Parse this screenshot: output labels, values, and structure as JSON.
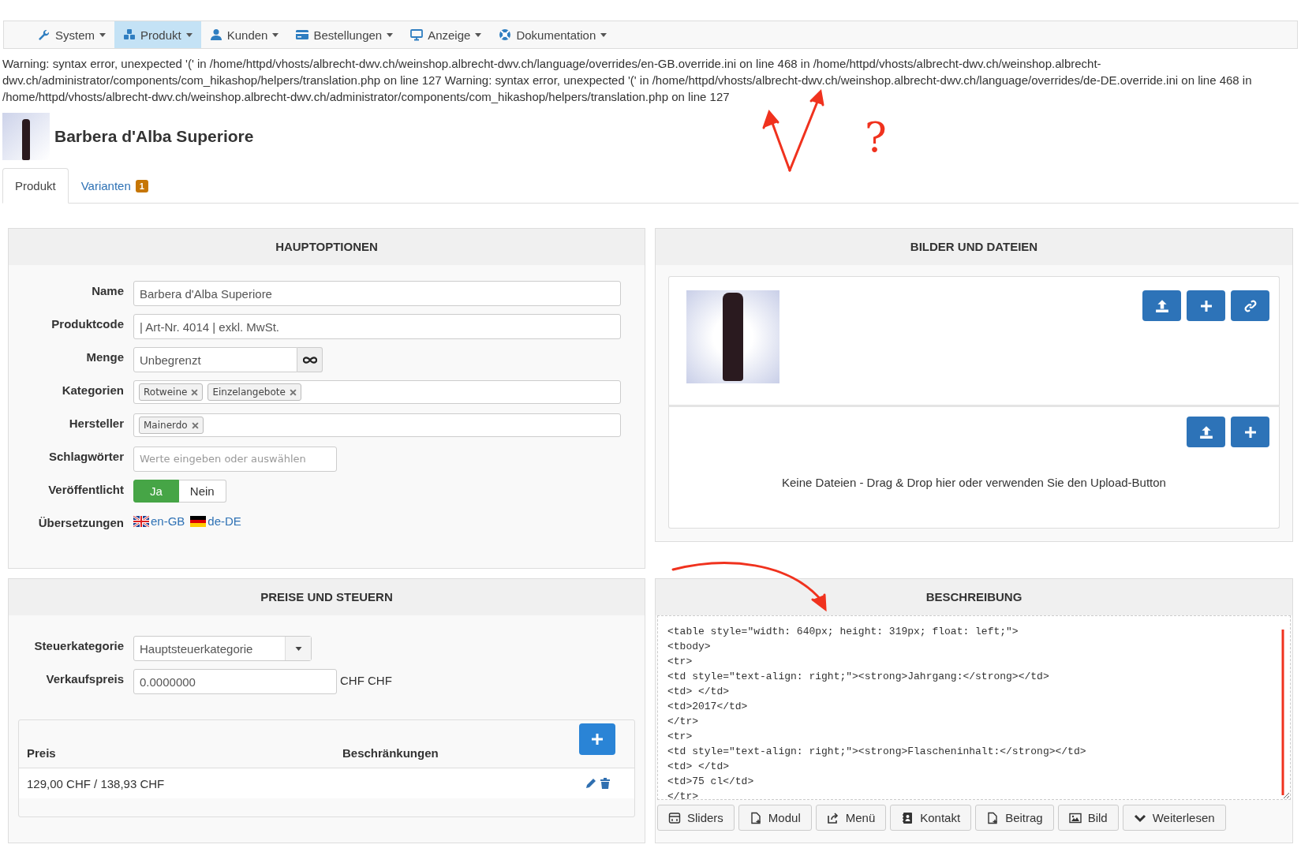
{
  "navbar": [
    {
      "label": "System",
      "selected": false
    },
    {
      "label": "Produkt",
      "selected": true
    },
    {
      "label": "Kunden",
      "selected": false
    },
    {
      "label": "Bestellungen",
      "selected": false
    },
    {
      "label": "Anzeige",
      "selected": false
    },
    {
      "label": "Dokumentation",
      "selected": false
    }
  ],
  "warning": "Warning: syntax error, unexpected '(' in /home/httpd/vhosts/albrecht-dwv.ch/weinshop.albrecht-dwv.ch/language/overrides/en-GB.override.ini on line 468 in /home/httpd/vhosts/albrecht-dwv.ch/weinshop.albrecht-dwv.ch/administrator/components/com_hikashop/helpers/translation.php on line 127 Warning: syntax error, unexpected '(' in /home/httpd/vhosts/albrecht-dwv.ch/weinshop.albrecht-dwv.ch/language/overrides/de-DE.override.ini on line 468 in /home/httpd/vhosts/albrecht-dwv.ch/weinshop.albrecht-dwv.ch/administrator/components/com_hikashop/helpers/translation.php on line 127",
  "annotation": {
    "question_mark": "?"
  },
  "product": {
    "title": "Barbera d'Alba Superiore"
  },
  "tabs": [
    {
      "label": "Produkt",
      "selected": true
    },
    {
      "label": "Varianten",
      "badge": "1",
      "selected": false
    }
  ],
  "main_options": {
    "title": "HAUPTOPTIONEN",
    "fields": [
      {
        "kind": "text",
        "label": "Name",
        "value": "Barbera d'Alba Superiore"
      },
      {
        "kind": "text",
        "label": "Produktcode",
        "value": "| Art-Nr. 4014 | exkl. MwSt."
      },
      {
        "kind": "quantity",
        "label": "Menge",
        "value": "Unbegrenzt"
      },
      {
        "kind": "tags",
        "label": "Kategorien",
        "tags": [
          "Rotweine",
          "Einzelangebote"
        ]
      },
      {
        "kind": "tags",
        "label": "Hersteller",
        "tags": [
          "Mainerdo"
        ]
      },
      {
        "kind": "placeholder",
        "label": "Schlagwörter",
        "placeholder": "Werte eingeben oder auswählen"
      },
      {
        "kind": "toggle",
        "label": "Veröffentlicht",
        "options": [
          {
            "label": "Ja",
            "selected": true
          },
          {
            "label": "Nein",
            "selected": false
          }
        ]
      },
      {
        "kind": "links",
        "label": "Übersetzungen",
        "links": [
          "en-GB",
          "de-DE"
        ]
      }
    ]
  },
  "images_files": {
    "title": "BILDER UND DATEIEN",
    "empty_text": "Keine Dateien - Drag & Drop hier oder verwenden Sie den Upload-Button"
  },
  "prices": {
    "title": "PREISE UND STEUERN",
    "tax_label": "Steuerkategorie",
    "tax_value": "Hauptsteuerkategorie",
    "price_label": "Verkaufspreis",
    "price_value": "0.0000000",
    "currency": "CHF CHF",
    "columns": [
      "Preis",
      "Beschränkungen"
    ],
    "rows": [
      {
        "price": "129,00 CHF / 138,93 CHF"
      }
    ]
  },
  "description": {
    "title": "BESCHREIBUNG",
    "code_lines": [
      "<table style=\"width: 640px; height: 319px; float: left;\">",
      "<tbody>",
      "<tr>",
      "<td style=\"text-align: right;\"><strong>Jahrgang:</strong></td>",
      "<td> </td>",
      "<td>2017</td>",
      "</tr>",
      "<tr>",
      "<td style=\"text-align: right;\"><strong>Flascheninhalt:</strong></td>",
      "<td> </td>",
      "<td>75 cl</td>",
      "</tr>"
    ],
    "buttons": [
      "Sliders",
      "Modul",
      "Menü",
      "Kontakt",
      "Beitrag",
      "Bild",
      "Weiterlesen"
    ]
  }
}
